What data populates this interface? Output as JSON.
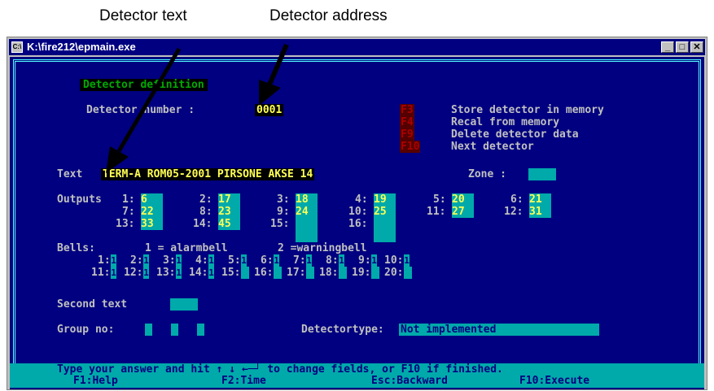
{
  "annotations": {
    "text_label": "Detector text",
    "address_label": "Detector address"
  },
  "window": {
    "title": "K:\\fire212\\epmain.exe",
    "minimize": "_",
    "maximize": "□",
    "close": "✕"
  },
  "screen": {
    "section_title": "Detector definition",
    "detector_number_label": "Detector number :",
    "detector_number": "0001",
    "fkeys": [
      {
        "key": "F3",
        "label": "Store detector in memory"
      },
      {
        "key": "F4",
        "label": "Recal from memory"
      },
      {
        "key": "F9",
        "label": "Delete detector data"
      },
      {
        "key": "F10",
        "label": "Next detector"
      }
    ],
    "text_label": "Text",
    "text_value": "TERM-A ROM05-2001 PIRSONE AKSE 14",
    "zone_label": "Zone :",
    "zone_value": "",
    "outputs_label": "Outputs",
    "outputs": [
      {
        "num": "1:",
        "val": "6"
      },
      {
        "num": "2:",
        "val": "17"
      },
      {
        "num": "3:",
        "val": "18"
      },
      {
        "num": "4:",
        "val": "19"
      },
      {
        "num": "5:",
        "val": "20"
      },
      {
        "num": "6:",
        "val": "21"
      },
      {
        "num": "7:",
        "val": "22"
      },
      {
        "num": "8:",
        "val": "23"
      },
      {
        "num": "9:",
        "val": "24"
      },
      {
        "num": "10:",
        "val": "25"
      },
      {
        "num": "11:",
        "val": "27"
      },
      {
        "num": "12:",
        "val": "31"
      },
      {
        "num": "13:",
        "val": "33"
      },
      {
        "num": "14:",
        "val": "45"
      },
      {
        "num": "15:",
        "val": ""
      },
      {
        "num": "16:",
        "val": ""
      }
    ],
    "bells_label": "Bells:",
    "bells_legend1": "1 = alarmbell",
    "bells_legend2": "2 =warningbell",
    "bells": [
      {
        "num": "1:",
        "val": "1"
      },
      {
        "num": "2:",
        "val": "1"
      },
      {
        "num": "3:",
        "val": "1"
      },
      {
        "num": "4:",
        "val": "1"
      },
      {
        "num": "5:",
        "val": "1"
      },
      {
        "num": "6:",
        "val": "1"
      },
      {
        "num": "7:",
        "val": "1"
      },
      {
        "num": "8:",
        "val": "1"
      },
      {
        "num": "9:",
        "val": "1"
      },
      {
        "num": "10:",
        "val": "1"
      },
      {
        "num": "11:",
        "val": "1"
      },
      {
        "num": "12:",
        "val": "1"
      },
      {
        "num": "13:",
        "val": "1"
      },
      {
        "num": "14:",
        "val": "1"
      },
      {
        "num": "15:",
        "val": ""
      },
      {
        "num": "16:",
        "val": ""
      },
      {
        "num": "17:",
        "val": ""
      },
      {
        "num": "18:",
        "val": ""
      },
      {
        "num": "19:",
        "val": ""
      },
      {
        "num": "20:",
        "val": ""
      }
    ],
    "second_text_label": "Second text",
    "group_label": "Group no:",
    "detectortype_label": "Detectortype:",
    "detectortype_value": "Not implemented",
    "status_line1": "Type your answer and hit ↑ ↓ ←─┘ to change fields, or F10 if finished.",
    "status_keys": [
      "F1:Help",
      "F2:Time",
      "Esc:Backward",
      "F10:Execute"
    ]
  },
  "colors": {
    "background": "#000080",
    "field": "#00aaaa",
    "highlight": "#ffff55",
    "title_green": "#00aa00"
  }
}
